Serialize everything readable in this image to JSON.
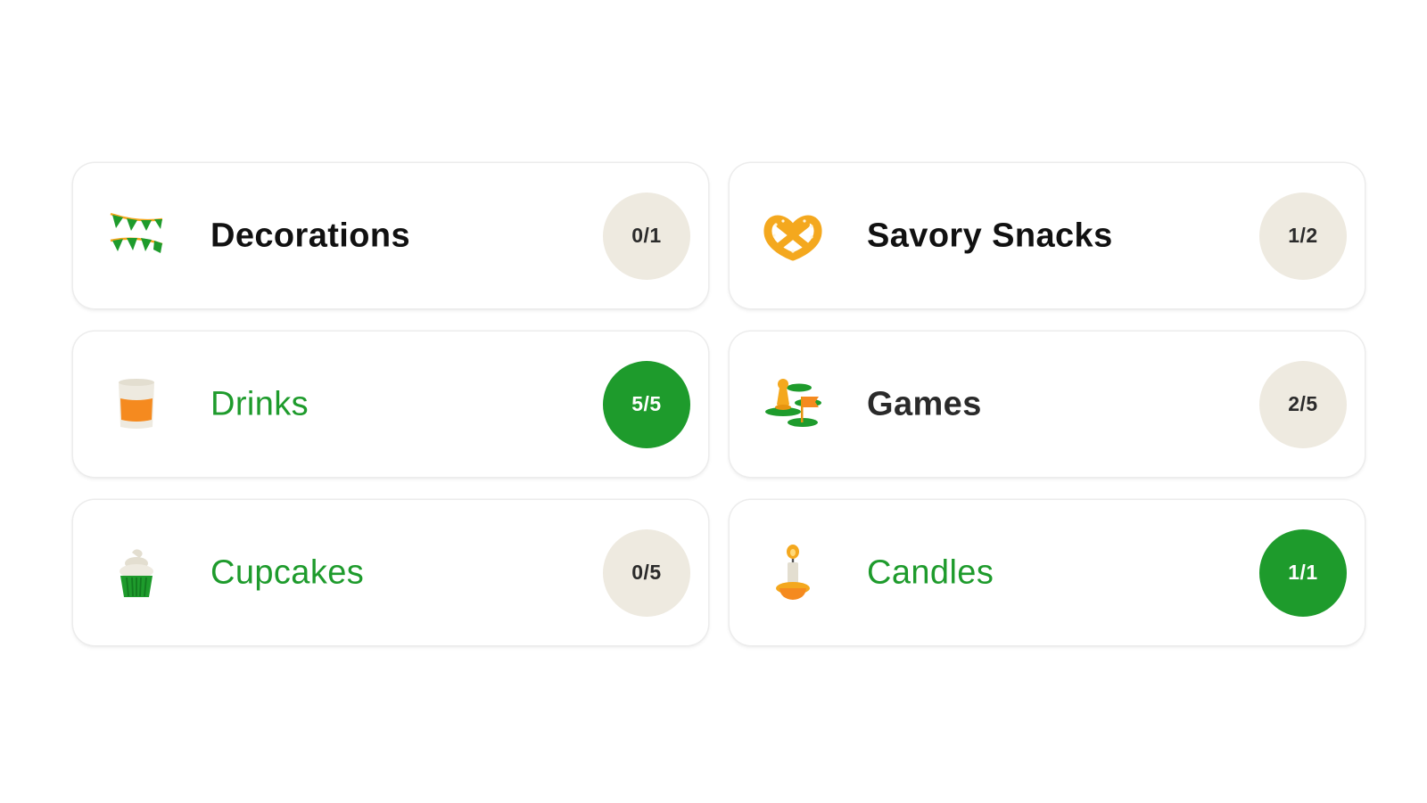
{
  "colors": {
    "accent_green": "#1e9b2c",
    "badge_pending_bg": "#eeeae0",
    "orange": "#f4a81e"
  },
  "categories": [
    {
      "label": "Decorations",
      "progress": "0/1",
      "icon": "bunting-icon",
      "complete": false
    },
    {
      "label": "Savory Snacks",
      "progress": "1/2",
      "icon": "pretzel-icon",
      "complete": false
    },
    {
      "label": "Drinks",
      "progress": "5/5",
      "icon": "drink-glass-icon",
      "complete": true
    },
    {
      "label": "Games",
      "progress": "2/5",
      "icon": "game-pieces-icon",
      "complete": false
    },
    {
      "label": "Cupcakes",
      "progress": "0/5",
      "icon": "cupcake-icon",
      "complete": false
    },
    {
      "label": "Candles",
      "progress": "1/1",
      "icon": "candle-icon",
      "complete": true
    }
  ]
}
